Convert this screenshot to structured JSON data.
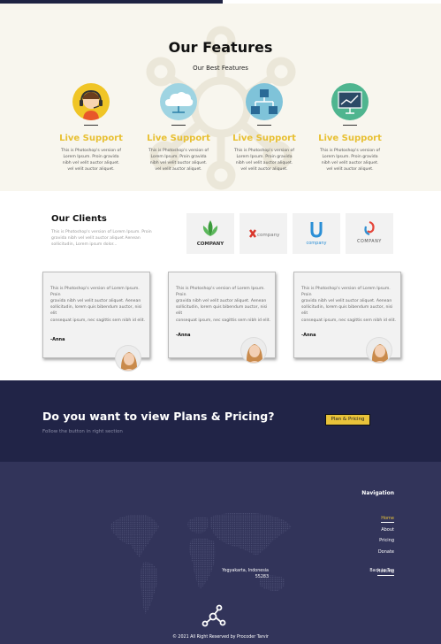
{
  "features": {
    "title": "Our Features",
    "subtitle": "Our Best Features",
    "items": [
      {
        "title": "Live Support",
        "desc": "This is Photoshop's version of Lorem Ipsum. Proin gravida nibh vel velit auctor aliquet. vel velit auctor aliquet.",
        "icon": "headset-support-icon"
      },
      {
        "title": "Live Support",
        "desc": "This is Photoshop's version of Lorem Ipsum. Proin gravida nibh vel velit auctor aliquet. vel velit auctor aliquet.",
        "icon": "cloud-icon"
      },
      {
        "title": "Live Support",
        "desc": "This is Photoshop's version of Lorem Ipsum. Proin gravida nibh vel velit auctor aliquet. vel velit auctor aliquet.",
        "icon": "network-icon"
      },
      {
        "title": "Live Support",
        "desc": "This is Photoshop's version of Lorem Ipsum. Proin gravida nibh vel velit auctor aliquet. vel velit auctor aliquet.",
        "icon": "presentation-chart-icon"
      }
    ]
  },
  "clients": {
    "title": "Our Clients",
    "desc": "This is Photoshop's version of Lorem Ipsum. Proin gravida nibh vel velit auctor aliquet Aenean sollicitudin, Lorem ipsum dolor...",
    "logos": [
      {
        "name": "COMPANY",
        "icon": "leaf-logo-icon"
      },
      {
        "name": "company",
        "icon": "x-logo-icon"
      },
      {
        "name": "company",
        "icon": "u-logo-icon"
      },
      {
        "name": "COMPANY",
        "icon": "swirl-logo-icon"
      }
    ]
  },
  "testimonials": [
    {
      "quote": "This is Photoshop's version of Lorem Ipsum. Proin\ngravida nibh vel velit auctor aliquet. Aenean sollicitudin, lorem quis bibendum auctor, nisi elit\nconsequat ipsum, nec sagittis sem nibh id elit.",
      "author": "-Anna"
    },
    {
      "quote": "This is Photoshop's version of Lorem Ipsum. Proin\ngravida nibh vel velit auctor aliquet. Aenean sollicitudin, lorem quis bibendum auctor, nisi elit\nconsequat ipsum, nec sagittis sem nibh id elit.",
      "author": "-Anna"
    },
    {
      "quote": "This is Photoshop's version of Lorem Ipsum. Proin\ngravida nibh vel velit auctor aliquet. Aenean sollicitudin, lorem quis bibendum auctor, nisi elit\nconsequat ipsum, nec sagittis sem nibh id elit.",
      "author": "-Anna"
    }
  ],
  "cta": {
    "title": "Do you want to view Plans & Pricing?",
    "subtitle": "Follow the button in right section",
    "button": "Plan & Pricing"
  },
  "footer": {
    "nav_title": "Navigation",
    "nav": [
      "Home",
      "About",
      "Pricing",
      "Donate",
      "Hosting"
    ],
    "address_line1": "Yogyakarta, Indonesia",
    "address_line2": "55283",
    "back_to_top": "Back to Top",
    "copyright": "© 2021 All Right Reserved by Procoder Tarvir"
  },
  "colors": {
    "accent": "#e9c33a",
    "dark_navy": "#212447",
    "footer_bg": "#32345a",
    "features_bg": "#f8f6ee"
  }
}
